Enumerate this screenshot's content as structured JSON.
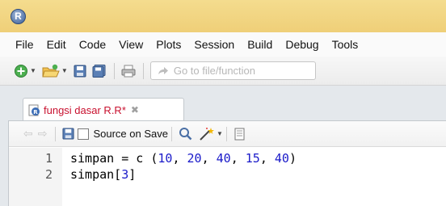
{
  "menu": [
    "File",
    "Edit",
    "Code",
    "View",
    "Plots",
    "Session",
    "Build",
    "Debug",
    "Tools"
  ],
  "toolbar": {
    "goto_placeholder": "Go to file/function"
  },
  "editor": {
    "tab_title": "fungsi dasar R.R*",
    "source_on_save_label": "Source on Save",
    "lines": [
      {
        "number": "1",
        "parts": [
          {
            "t": "simpan = c (",
            "c": "sym"
          },
          {
            "t": "10",
            "c": "num"
          },
          {
            "t": ", ",
            "c": "sym"
          },
          {
            "t": "20",
            "c": "num"
          },
          {
            "t": ", ",
            "c": "sym"
          },
          {
            "t": "40",
            "c": "num"
          },
          {
            "t": ", ",
            "c": "sym"
          },
          {
            "t": "15",
            "c": "num"
          },
          {
            "t": ", ",
            "c": "sym"
          },
          {
            "t": "40",
            "c": "num"
          },
          {
            "t": ")",
            "c": "sym"
          }
        ]
      },
      {
        "number": "2",
        "parts": [
          {
            "t": "simpan[",
            "c": "sym"
          },
          {
            "t": "3",
            "c": "num"
          },
          {
            "t": "]",
            "c": "sym"
          }
        ]
      }
    ]
  }
}
